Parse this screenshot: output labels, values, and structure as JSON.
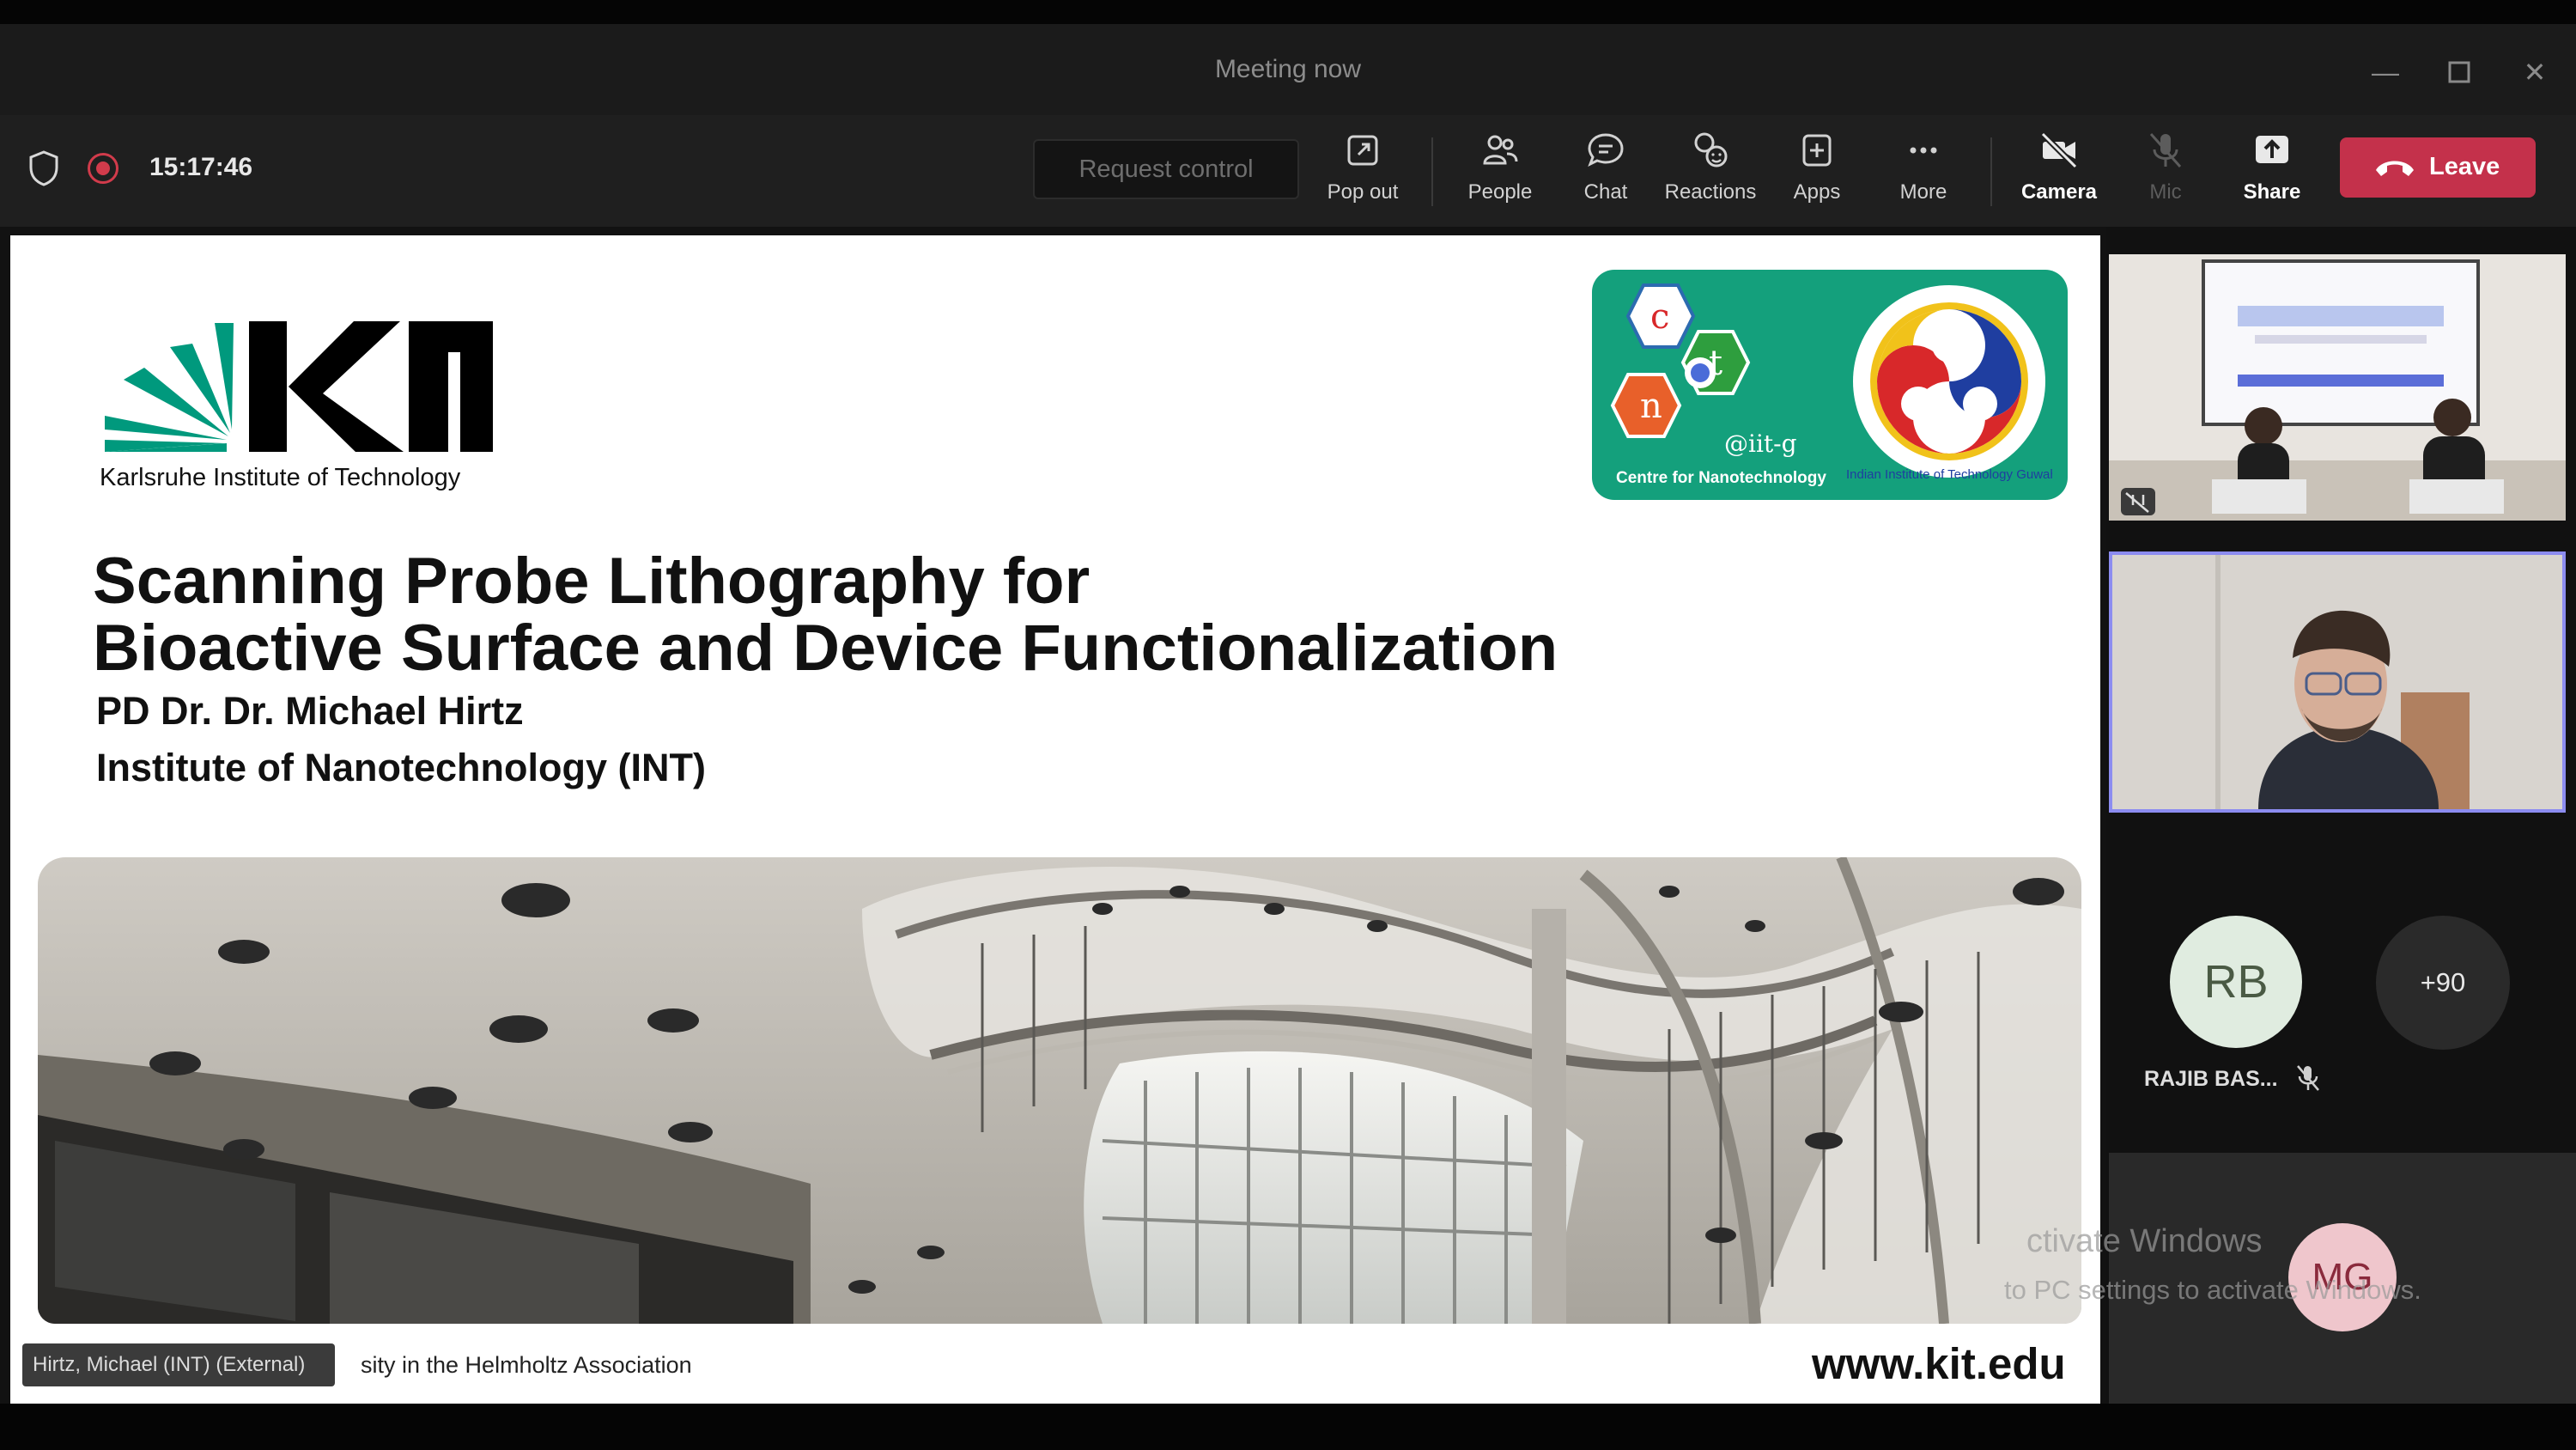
{
  "window": {
    "title": "Meeting now",
    "controls": [
      "minimize-icon",
      "maximize-icon",
      "close-icon"
    ]
  },
  "toolbar": {
    "timer": "15:17:46",
    "request_control": "Request control",
    "pop_out": "Pop out",
    "people": "People",
    "chat": "Chat",
    "reactions": "Reactions",
    "apps": "Apps",
    "more": "More",
    "camera": "Camera",
    "mic": "Mic",
    "share": "Share",
    "leave": "Leave",
    "colors": {
      "record": "#d13b4b",
      "leave": "#c4314b"
    }
  },
  "slide": {
    "kit_name": "Karlsruhe Institute of Technology",
    "cnt_letters": [
      "c",
      "n",
      "t"
    ],
    "cnt_iitg": "@iit-g",
    "cnt_caption": "Centre for Nanotechnology",
    "iitg_arc_text": "Indian Institute of Technology Guwahati",
    "title_line1": "Scanning Probe Lithography for",
    "title_line2": "Bioactive Surface and Device Functionalization",
    "author": "PD Dr. Dr. Michael Hirtz",
    "institute": "Institute of Nanotechnology (INT)",
    "footer_text": "sity in the Helmholtz Association",
    "url": "www.kit.edu"
  },
  "presenter_tag": "Hirtz, Michael (INT) (External)",
  "participants": {
    "rb_initials": "RB",
    "rb_name": "RAJIB BAS...",
    "overflow": "+90",
    "self_initials": "MG"
  },
  "watermark": {
    "line1": "ctivate Windows",
    "line2": "to PC settings to activate Windows."
  }
}
